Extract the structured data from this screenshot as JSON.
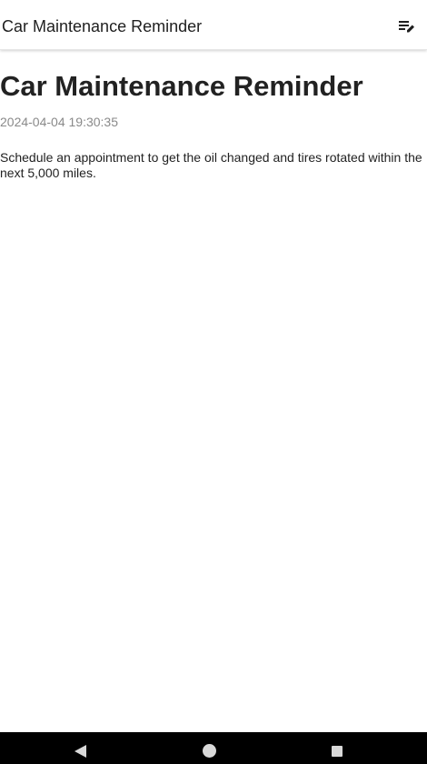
{
  "app_bar": {
    "title": "Car Maintenance Reminder",
    "edit_icon": "edit-note-icon"
  },
  "note": {
    "title": "Car Maintenance Reminder",
    "timestamp": "2024-04-04 19:30:35",
    "body": "Schedule an appointment to get the oil changed and tires rotated within the next 5,000 miles."
  },
  "nav_bar": {
    "back_icon": "back-triangle-icon",
    "home_icon": "home-circle-icon",
    "recents_icon": "recents-square-icon"
  },
  "colors": {
    "background": "#ffffff",
    "title_text": "#222222",
    "timestamp_text": "#8a8a8a",
    "nav_bar": "#000000",
    "nav_icons": "#d9d9d9"
  }
}
